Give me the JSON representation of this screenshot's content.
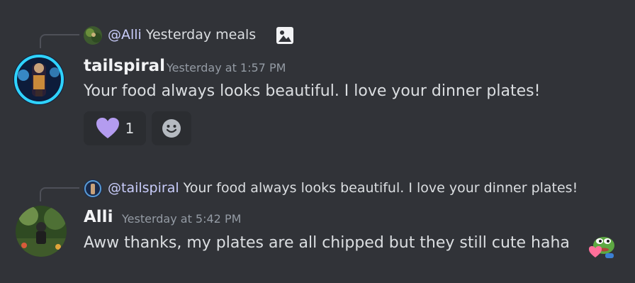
{
  "messages": [
    {
      "reply": {
        "mention": "@Alli",
        "content": "Yesterday meals",
        "attachment_icon": "image-icon"
      },
      "username": "tailspiral",
      "timestamp": "Yesterday at 1:57 PM",
      "text": "Your food always looks beautiful. I love your dinner plates!",
      "reactions": [
        {
          "icon": "purple-heart-icon",
          "count": "1"
        },
        {
          "icon": "add-reaction-icon"
        }
      ]
    },
    {
      "reply": {
        "mention": "@tailspiral",
        "content": "Your food always looks beautiful. I love your dinner plates!"
      },
      "username": "Alli",
      "timestamp": "Yesterday at 5:42 PM",
      "text": "Aww thanks, my plates are all chipped but they still cute haha",
      "emoji": "pepe-heart-emoji"
    }
  ],
  "colors": {
    "background": "#313338",
    "accent_heart": "#b49cf0",
    "reaction_bg": "#2b2d31"
  }
}
